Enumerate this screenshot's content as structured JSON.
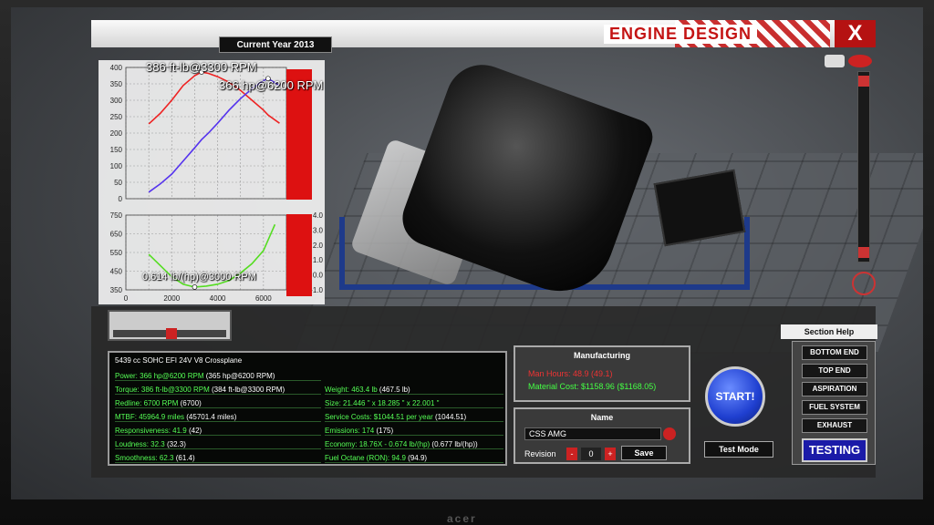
{
  "window": {
    "title": "ENGINE DESIGN",
    "close_label": "X",
    "current_year": "Current Year 2013"
  },
  "brand": "acer",
  "chart_data": [
    {
      "type": "line",
      "x": [
        1000,
        1500,
        2000,
        2500,
        3000,
        3300,
        3600,
        4000,
        4500,
        5000,
        5500,
        6000,
        6200,
        6700
      ],
      "series": [
        {
          "values": [
            228,
            260,
            300,
            345,
            375,
            386,
            382,
            372,
            355,
            330,
            300,
            270,
            255,
            230
          ],
          "color": "#ee2222"
        },
        {
          "values": [
            20,
            45,
            75,
            115,
            155,
            180,
            200,
            230,
            270,
            305,
            335,
            360,
            366,
            345
          ],
          "color": "#5533ee"
        }
      ],
      "annotations": [
        "386 ft-lb@3300 RPM",
        "366 hp@6200 RPM"
      ],
      "yticks": [
        "400",
        "350",
        "300",
        "250",
        "200",
        "150",
        "100",
        "50",
        "0"
      ],
      "ylim": [
        0,
        400
      ],
      "xlim": [
        0,
        7000
      ]
    },
    {
      "type": "line",
      "x": [
        1000,
        1500,
        2000,
        2500,
        3000,
        3500,
        4000,
        4500,
        5000,
        5500,
        6000,
        6500
      ],
      "series": [
        {
          "values": [
            540,
            480,
            420,
            380,
            365,
            370,
            380,
            400,
            440,
            490,
            560,
            700
          ],
          "color": "#55dd22"
        }
      ],
      "annotations": [
        "0.614 lb/(hp)@3000 RPM"
      ],
      "yticks": [
        "750",
        "650",
        "550",
        "450",
        "350"
      ],
      "yticks_right": [
        "4.0",
        "3.0",
        "2.0",
        "1.0",
        "0.0",
        "-1.0"
      ],
      "xticks": [
        "0",
        "2000",
        "4000",
        "6000"
      ],
      "ylim": [
        350,
        750
      ],
      "xlim": [
        0,
        7000
      ]
    }
  ],
  "stats": {
    "engine_name": "5439 cc SOHC EFI 24V V8 Crossplane",
    "left": [
      {
        "label": "Power: 366 hp@6200 RPM",
        "prev": "(365 hp@6200 RPM)"
      },
      {
        "label": "Torque: 386 ft-lb@3300 RPM",
        "prev": "(384 ft-lb@3300 RPM)"
      },
      {
        "label": "Redline: 6700 RPM",
        "prev": "(6700)"
      },
      {
        "label": "MTBF: 45964.9 miles",
        "prev": "(45701.4 miles)"
      },
      {
        "label": "Responsiveness: 41.9",
        "prev": "(42)"
      },
      {
        "label": "Loudness: 32.3",
        "prev": "(32.3)"
      },
      {
        "label": "Smoothness: 62.3",
        "prev": "(61.4)"
      }
    ],
    "right": [
      {
        "label": "Weight: 463.4 lb",
        "prev": "(467.5 lb)"
      },
      {
        "label": "Size: 21.446 \" x 18.285 \" x 22.001 \"",
        "prev": ""
      },
      {
        "label": "Service Costs: $1044.51 per year",
        "prev": "(1044.51)"
      },
      {
        "label": "Emissions: 174",
        "prev": "(175)"
      },
      {
        "label": "Economy: 18.76X - 0.674 lb/(hp)",
        "prev": "(0.677 lb/(hp))"
      },
      {
        "label": "Fuel Octane (RON): 94.9",
        "prev": "(94.9)"
      }
    ]
  },
  "manufacturing": {
    "title": "Manufacturing",
    "man_hours": "Man Hours: 48.9 (49.1)",
    "material_cost": "Material Cost: $1158.96 ($1168.05)"
  },
  "name_panel": {
    "title": "Name",
    "value": "CSS AMG",
    "revision_label": "Revision",
    "revision_value": "0",
    "minus": "-",
    "plus": "+",
    "save_label": "Save"
  },
  "start_label": "START!",
  "test_mode_label": "Test Mode",
  "section_help": "Section Help",
  "sections": [
    "BOTTOM END",
    "TOP END",
    "ASPIRATION",
    "FUEL SYSTEM",
    "EXHAUST",
    "TESTING"
  ]
}
